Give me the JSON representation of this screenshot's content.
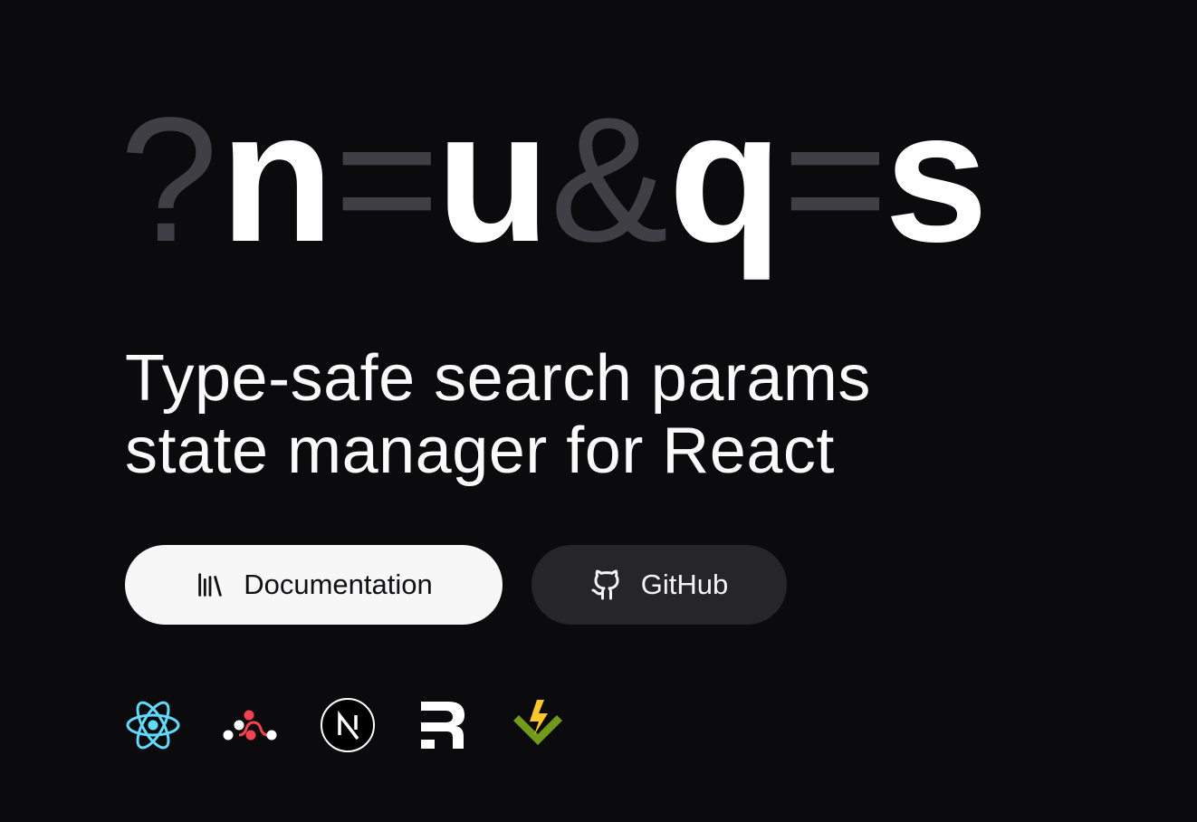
{
  "logo": {
    "chars": [
      "?",
      "n",
      "=",
      "u",
      "&",
      "q",
      "=",
      "s"
    ]
  },
  "tagline": {
    "line1": "Type-safe search params",
    "line2": "state manager for React"
  },
  "buttons": {
    "docs_label": "Documentation",
    "docs_icon": "library-icon",
    "github_label": "GitHub",
    "github_icon": "github-icon"
  },
  "frameworks": [
    {
      "name": "react-icon",
      "color": "#61dafb"
    },
    {
      "name": "react-router-icon",
      "color": "#f44250"
    },
    {
      "name": "nextjs-icon",
      "color": "#ffffff"
    },
    {
      "name": "remix-icon",
      "color": "#ffffff"
    },
    {
      "name": "vitest-icon",
      "color": "#fcc72b"
    }
  ],
  "colors": {
    "background": "#0b0b0d",
    "logo_dim": "#3f3f45",
    "logo_bright": "#ffffff",
    "docs_button_bg": "#f7f7f7",
    "github_button_bg": "#26262a"
  }
}
